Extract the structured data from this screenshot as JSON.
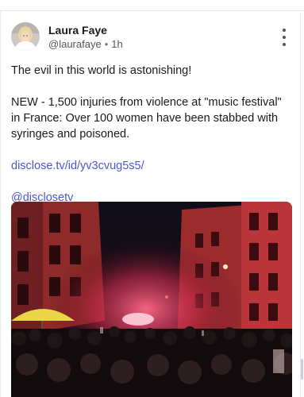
{
  "post": {
    "author": {
      "name": "Laura Faye",
      "handle": "@laurafaye",
      "time": "1h",
      "avatar_icon": "user-avatar"
    },
    "more_icon": "more-vertical-icon",
    "text": {
      "line1": "The evil in this world is astonishing!",
      "line2": "NEW - 1,500 injuries from violence at \"music festival\" in France: Over 100 women have been stabbed with syringes and poisoned.",
      "link": "disclose.tv/id/yv3cvug5s5/",
      "mention": "@disclosetv"
    },
    "media": {
      "kind": "photo"
    }
  },
  "colors": {
    "link": "#4b58c9",
    "text": "#1a1a1a",
    "meta": "#555555"
  }
}
